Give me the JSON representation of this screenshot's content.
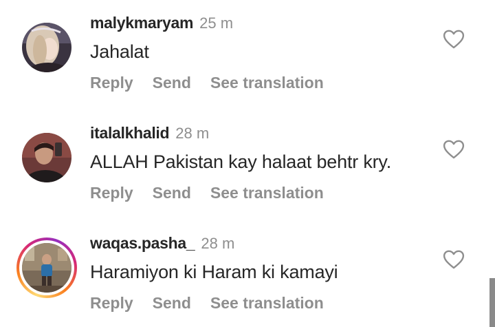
{
  "comments": [
    {
      "username": "malykmaryam",
      "time": "25 m",
      "text": "Jahalat",
      "actions": {
        "reply": "Reply",
        "send": "Send",
        "translate": "See translation"
      },
      "avatar": "profile-photo",
      "has_story_ring": false
    },
    {
      "username": "italalkhalid",
      "time": "28 m",
      "text": "ALLAH Pakistan kay halaat behtr kry.",
      "actions": {
        "reply": "Reply",
        "send": "Send",
        "translate": "See translation"
      },
      "avatar": "profile-photo",
      "has_story_ring": false
    },
    {
      "username": "waqas.pasha_",
      "time": "28 m",
      "text": "Haramiyon ki Haram ki kamayi",
      "actions": {
        "reply": "Reply",
        "send": "Send",
        "translate": "See translation"
      },
      "avatar": "profile-photo",
      "has_story_ring": true
    }
  ],
  "colors": {
    "username": "#262626",
    "secondary": "#8e8e8e",
    "story_ring": [
      "#feda75",
      "#fa7e1e",
      "#d62976",
      "#962fbf"
    ]
  },
  "icons": {
    "like": "heart-outline-icon"
  }
}
